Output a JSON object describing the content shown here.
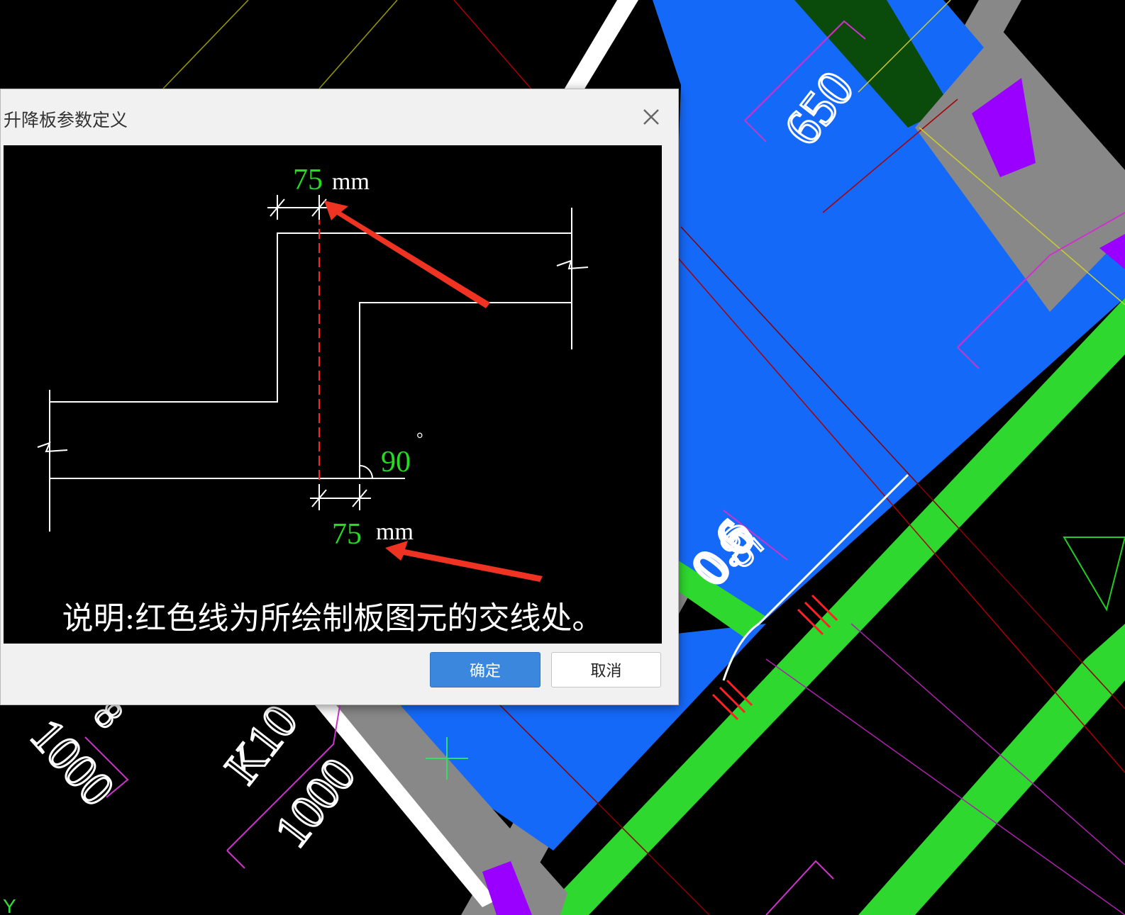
{
  "background": {
    "labels": {
      "top_right": "650",
      "mid_right_a": "65",
      "mid_right_b": "0.6",
      "left_a": "1000",
      "left_b": "K10",
      "left_c": "1000",
      "left_d": "8",
      "axis_y": "Y"
    }
  },
  "dialog": {
    "title": "升降板参数定义",
    "preview": {
      "dim_top_value": "75",
      "dim_top_unit": "mm",
      "dim_bottom_value": "75",
      "dim_bottom_unit": "mm",
      "angle_value": "90",
      "angle_unit": "°",
      "note": "说明:红色线为所绘制板图元的交线处。"
    },
    "buttons": {
      "ok": "确定",
      "cancel": "取消"
    }
  },
  "colors": {
    "blue_slab": "#1569f8",
    "green_beam": "#2ed82e",
    "gray_wall": "#888888",
    "dim_green": "#22dd22",
    "arrow_red": "#ee3322",
    "ok_blue": "#3a87dd"
  },
  "icons": {
    "close": "close-icon"
  }
}
